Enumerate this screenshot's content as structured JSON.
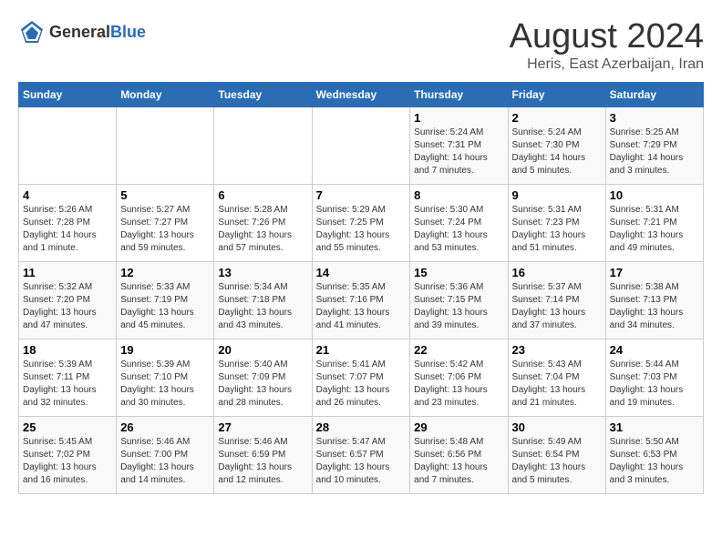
{
  "header": {
    "logo_general": "General",
    "logo_blue": "Blue",
    "title": "August 2024",
    "subtitle": "Heris, East Azerbaijan, Iran"
  },
  "calendar": {
    "days_of_week": [
      "Sunday",
      "Monday",
      "Tuesday",
      "Wednesday",
      "Thursday",
      "Friday",
      "Saturday"
    ],
    "weeks": [
      [
        {
          "day": "",
          "info": ""
        },
        {
          "day": "",
          "info": ""
        },
        {
          "day": "",
          "info": ""
        },
        {
          "day": "",
          "info": ""
        },
        {
          "day": "1",
          "info": "Sunrise: 5:24 AM\nSunset: 7:31 PM\nDaylight: 14 hours\nand 7 minutes."
        },
        {
          "day": "2",
          "info": "Sunrise: 5:24 AM\nSunset: 7:30 PM\nDaylight: 14 hours\nand 5 minutes."
        },
        {
          "day": "3",
          "info": "Sunrise: 5:25 AM\nSunset: 7:29 PM\nDaylight: 14 hours\nand 3 minutes."
        }
      ],
      [
        {
          "day": "4",
          "info": "Sunrise: 5:26 AM\nSunset: 7:28 PM\nDaylight: 14 hours\nand 1 minute."
        },
        {
          "day": "5",
          "info": "Sunrise: 5:27 AM\nSunset: 7:27 PM\nDaylight: 13 hours\nand 59 minutes."
        },
        {
          "day": "6",
          "info": "Sunrise: 5:28 AM\nSunset: 7:26 PM\nDaylight: 13 hours\nand 57 minutes."
        },
        {
          "day": "7",
          "info": "Sunrise: 5:29 AM\nSunset: 7:25 PM\nDaylight: 13 hours\nand 55 minutes."
        },
        {
          "day": "8",
          "info": "Sunrise: 5:30 AM\nSunset: 7:24 PM\nDaylight: 13 hours\nand 53 minutes."
        },
        {
          "day": "9",
          "info": "Sunrise: 5:31 AM\nSunset: 7:23 PM\nDaylight: 13 hours\nand 51 minutes."
        },
        {
          "day": "10",
          "info": "Sunrise: 5:31 AM\nSunset: 7:21 PM\nDaylight: 13 hours\nand 49 minutes."
        }
      ],
      [
        {
          "day": "11",
          "info": "Sunrise: 5:32 AM\nSunset: 7:20 PM\nDaylight: 13 hours\nand 47 minutes."
        },
        {
          "day": "12",
          "info": "Sunrise: 5:33 AM\nSunset: 7:19 PM\nDaylight: 13 hours\nand 45 minutes."
        },
        {
          "day": "13",
          "info": "Sunrise: 5:34 AM\nSunset: 7:18 PM\nDaylight: 13 hours\nand 43 minutes."
        },
        {
          "day": "14",
          "info": "Sunrise: 5:35 AM\nSunset: 7:16 PM\nDaylight: 13 hours\nand 41 minutes."
        },
        {
          "day": "15",
          "info": "Sunrise: 5:36 AM\nSunset: 7:15 PM\nDaylight: 13 hours\nand 39 minutes."
        },
        {
          "day": "16",
          "info": "Sunrise: 5:37 AM\nSunset: 7:14 PM\nDaylight: 13 hours\nand 37 minutes."
        },
        {
          "day": "17",
          "info": "Sunrise: 5:38 AM\nSunset: 7:13 PM\nDaylight: 13 hours\nand 34 minutes."
        }
      ],
      [
        {
          "day": "18",
          "info": "Sunrise: 5:39 AM\nSunset: 7:11 PM\nDaylight: 13 hours\nand 32 minutes."
        },
        {
          "day": "19",
          "info": "Sunrise: 5:39 AM\nSunset: 7:10 PM\nDaylight: 13 hours\nand 30 minutes."
        },
        {
          "day": "20",
          "info": "Sunrise: 5:40 AM\nSunset: 7:09 PM\nDaylight: 13 hours\nand 28 minutes."
        },
        {
          "day": "21",
          "info": "Sunrise: 5:41 AM\nSunset: 7:07 PM\nDaylight: 13 hours\nand 26 minutes."
        },
        {
          "day": "22",
          "info": "Sunrise: 5:42 AM\nSunset: 7:06 PM\nDaylight: 13 hours\nand 23 minutes."
        },
        {
          "day": "23",
          "info": "Sunrise: 5:43 AM\nSunset: 7:04 PM\nDaylight: 13 hours\nand 21 minutes."
        },
        {
          "day": "24",
          "info": "Sunrise: 5:44 AM\nSunset: 7:03 PM\nDaylight: 13 hours\nand 19 minutes."
        }
      ],
      [
        {
          "day": "25",
          "info": "Sunrise: 5:45 AM\nSunset: 7:02 PM\nDaylight: 13 hours\nand 16 minutes."
        },
        {
          "day": "26",
          "info": "Sunrise: 5:46 AM\nSunset: 7:00 PM\nDaylight: 13 hours\nand 14 minutes."
        },
        {
          "day": "27",
          "info": "Sunrise: 5:46 AM\nSunset: 6:59 PM\nDaylight: 13 hours\nand 12 minutes."
        },
        {
          "day": "28",
          "info": "Sunrise: 5:47 AM\nSunset: 6:57 PM\nDaylight: 13 hours\nand 10 minutes."
        },
        {
          "day": "29",
          "info": "Sunrise: 5:48 AM\nSunset: 6:56 PM\nDaylight: 13 hours\nand 7 minutes."
        },
        {
          "day": "30",
          "info": "Sunrise: 5:49 AM\nSunset: 6:54 PM\nDaylight: 13 hours\nand 5 minutes."
        },
        {
          "day": "31",
          "info": "Sunrise: 5:50 AM\nSunset: 6:53 PM\nDaylight: 13 hours\nand 3 minutes."
        }
      ]
    ]
  }
}
